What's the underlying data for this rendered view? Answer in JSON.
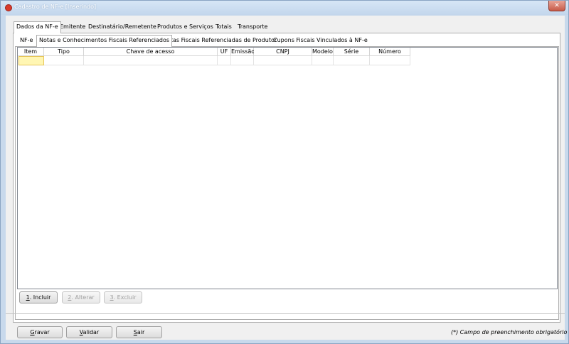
{
  "window": {
    "title": "Cadastro de NF-e [Inserindo]",
    "close_symbol": "✕"
  },
  "main_tabs": [
    {
      "label": "Dados da NF-e",
      "active": true
    },
    {
      "label": "Emitente",
      "active": false
    },
    {
      "label": "Destinatário/Remetente",
      "active": false
    },
    {
      "label": "Produtos e Serviços",
      "active": false
    },
    {
      "label": "Totais",
      "active": false
    },
    {
      "label": "Transporte",
      "active": false
    }
  ],
  "sub_tabs": [
    {
      "label": "NF-e",
      "active": false
    },
    {
      "label": "Notas e Conhecimentos Fiscais Referenciados",
      "active": true
    },
    {
      "label": "Notas Fiscais Referenciadas de Produtor",
      "active": false
    },
    {
      "label": "Cupons Fiscais Vinculados à NF-e",
      "active": false
    }
  ],
  "grid": {
    "columns": [
      "Item",
      "Tipo",
      "Chave de acesso",
      "UF",
      "Emissão",
      "CNPJ",
      "Modelo",
      "Série",
      "Número"
    ],
    "rows": []
  },
  "grid_buttons": {
    "incluir": {
      "accel": "1",
      "label": ". Incluir",
      "enabled": true
    },
    "alterar": {
      "accel": "2",
      "label": ". Alterar",
      "enabled": false
    },
    "excluir": {
      "accel": "3",
      "label": ". Excluir",
      "enabled": false
    }
  },
  "footer_buttons": {
    "gravar": {
      "accel": "G",
      "label": "ravar"
    },
    "validar": {
      "accel": "V",
      "label": "alidar"
    },
    "sair": {
      "accel": "S",
      "label": "air"
    }
  },
  "footnote": "(*) Campo de preenchimento obrigatório",
  "colors": {
    "title_bg": "#c3d6ec",
    "selected_cell": "#fff6b3",
    "close_button": "#c75a48"
  }
}
